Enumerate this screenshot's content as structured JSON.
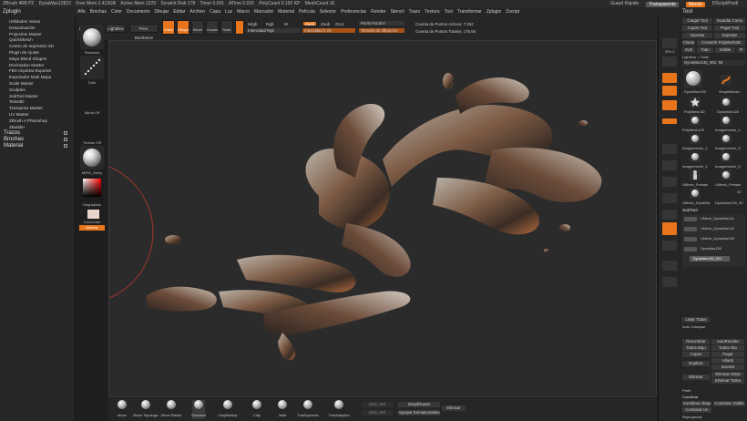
{
  "titlebar": {
    "parts": [
      "ZBrush 4R8 P2",
      "DynaWax12822",
      "Free Mem 2.413GB",
      "Active Mem 1229",
      "Scratch Disk 178",
      "Timer 0.001",
      "ATime 0.015",
      "PolyCount 0.192 KP",
      "MeshCount 16"
    ],
    "right": [
      "Guard Rápido",
      "Transparente",
      "Menús",
      "DScriptProdl"
    ]
  },
  "menubar": {
    "left_label": "Zplugin",
    "items": [
      "Alfa",
      "Brochas",
      "Color",
      "Documento",
      "Dibujar",
      "Editar",
      "Archivo",
      "Capa",
      "Luz",
      "Macro",
      "Marcador",
      "Material",
      "Película",
      "Selector",
      "Preferencias",
      "Render",
      "Stencil",
      "Trazo",
      "Textura",
      "Tool",
      "Transformar",
      "Zplugin",
      "Zscript"
    ],
    "right_label": "Tool"
  },
  "left_panel": {
    "items": [
      "Utilidades Varias",
      "Desactivación",
      "Projection Master",
      "QuickSketch",
      "Centro de Impresión 3D",
      "Plugin de Ajuste",
      "Maya Blend Shapes",
      "Decimation Master",
      "FBX Importar-Exportar",
      "Exportador Multi Mapa",
      "Scale Master",
      "Sculptes",
      "SubTool Master",
      "Tenis3D",
      "Transpose Master",
      "UV Master",
      "ZBrush A Photoshop",
      "ZBuilder"
    ],
    "sections": [
      "Trazos",
      "Brochas",
      "Material"
    ]
  },
  "brush_column": {
    "labels": [
      "Standard",
      "Dots",
      "Alpha Off",
      "Texture Off",
      "MRW_Shiny",
      "Degradado",
      "ColorColor",
      "Alternar"
    ]
  },
  "top_toolbar": {
    "buttons": [
      "Página Inicio",
      "LightBox",
      "Prev. Bombeine",
      "Editar",
      "Dibujar",
      "Mover",
      "Escala",
      "Rotar"
    ],
    "mode_buttons": [
      "Mrgb",
      "Rgb",
      "M",
      "Zadd",
      "Zsub",
      "Zcut"
    ],
    "sliders": [
      {
        "label": "Intensidad Rgb",
        "value": ""
      },
      {
        "label": "Intensidad Z 25",
        "value": "25"
      },
      {
        "label": "Punto Focal 0",
        "value": "0"
      },
      {
        "label": "Tamaño de dibujo 64",
        "value": "64"
      }
    ],
    "stats": [
      "Cuenta de Puntos Activos: 7,262",
      "Cuenta de Puntos Totales: 175.66"
    ],
    "zintensity": "Zmezcl"
  },
  "right_shelf": {
    "labels": [
      "SPix 3",
      "Scroll",
      "Zoom",
      "Actual",
      "AAHalf",
      "Persp",
      "Floor",
      "Local",
      "XYZ",
      "Frame",
      "Move",
      "Scale",
      "Rotate",
      "PolyF",
      "Transp"
    ]
  },
  "right_panel": {
    "buttons": [
      "Cargar Tool",
      "Guardar Como",
      "Copiar Tool",
      "Pegar Tool",
      "Importar",
      "Exportar",
      "Clonar",
      "Convertir PolyMesh3D",
      "GoZ",
      "Todo",
      "Visible",
      "R"
    ],
    "lightbox": "Lightbox > Tools",
    "current_tool": "DynaWax130_001: 55",
    "tool_names": [
      "DynaWax130",
      "SimpleBrush",
      "PolyMesh3D",
      "DynaWax128",
      "PolyMesh120",
      "Imagemeshe_1",
      "Imagemeshe_2",
      "Imagemeshe_3",
      "Imagemeshe_4",
      "Imagemeshe_5",
      "UMesh_Female",
      "UMesh_Female",
      "UMesh_DynaWa",
      "DynaWax130_00"
    ],
    "counter": "22",
    "subtool_header": "SubTool",
    "subtools": [
      "UMesh_DynaWax141",
      "UMesh_DynaWax140",
      "UMesh_DynaWax139",
      "DynaWax138",
      "DynaWax130_001"
    ],
    "lower_buttons": [
      "Listar Todos",
      "Auto Colapsar",
      "Renombrar",
      "AutoReorder",
      "Todos Bajo",
      "Todos Alto",
      "Copiar",
      "Pegar",
      "Duplicar",
      "Añadir",
      "Insertar",
      "Eliminar",
      "Eliminar Otras",
      "Eliminar Todos",
      "Partir",
      "Combinar"
    ],
    "footer": [
      "Combinar Abajo",
      "Combinar Visible",
      "Combinar Un",
      "Reproyectar"
    ]
  },
  "bottom_bar": {
    "brushes": [
      "Move",
      "Move Topologic",
      "Move Elastic",
      "Standard",
      "ClayBuildup",
      "Clay",
      "Inflat",
      "TrimDynamic",
      "TrimAdaptive"
    ],
    "toggles": [
      "Dam_Std",
      "Dam_Std",
      "Simplificador",
      "Agrupar Enmascarados",
      "Eliminar"
    ]
  },
  "colors": {
    "accent": "#e8741c",
    "panel": "#262626",
    "viewport": "#2b2b2b"
  }
}
